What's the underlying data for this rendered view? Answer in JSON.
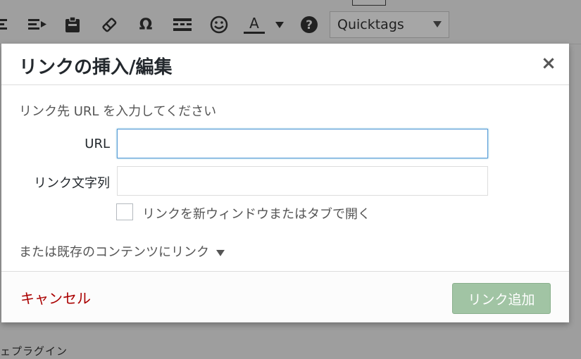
{
  "toolbar": {
    "icons": [
      "align-icon",
      "indent-icon",
      "paste-icon",
      "eraser-icon",
      "omega-icon",
      "hr-icon",
      "emoji-icon",
      "text-color-icon",
      "dropdown-icon",
      "help-icon"
    ],
    "quicktags_label": "Quicktags"
  },
  "background": {
    "bottom_text": "ェプラグイン"
  },
  "dialog": {
    "title": "リンクの挿入/編集",
    "close_glyph": "×",
    "instruction": "リンク先 URL を入力してください",
    "url_label": "URL",
    "url_value": "",
    "link_text_label": "リンク文字列",
    "link_text_value": "",
    "new_window_label": "リンクを新ウィンドウまたはタブで開く",
    "new_window_checked": false,
    "existing_content_label": "または既存のコンテンツにリンク",
    "cancel_label": "キャンセル",
    "submit_label": "リンク追加"
  },
  "colors": {
    "cancel": "#aa0000",
    "submit_bg": "#a1c4a4",
    "focus_border": "#5b9dd9"
  }
}
